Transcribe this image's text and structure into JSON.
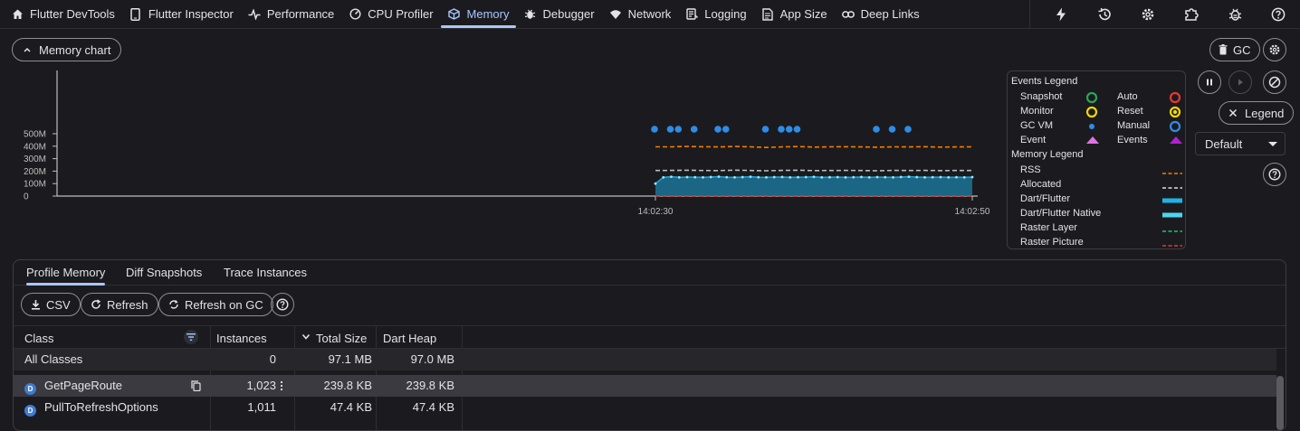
{
  "tabs": [
    {
      "id": "devtools",
      "label": "Flutter DevTools",
      "icon": "home-icon"
    },
    {
      "id": "inspector",
      "label": "Flutter Inspector",
      "icon": "phone-icon"
    },
    {
      "id": "performance",
      "label": "Performance",
      "icon": "pulse-icon"
    },
    {
      "id": "cpu",
      "label": "CPU Profiler",
      "icon": "timer-icon"
    },
    {
      "id": "memory",
      "label": "Memory",
      "icon": "cube-icon",
      "active": true
    },
    {
      "id": "debugger",
      "label": "Debugger",
      "icon": "bug-icon"
    },
    {
      "id": "network",
      "label": "Network",
      "icon": "wifi-icon"
    },
    {
      "id": "logging",
      "label": "Logging",
      "icon": "logging-icon"
    },
    {
      "id": "appsize",
      "label": "App Size",
      "icon": "file-icon"
    },
    {
      "id": "deeplinks",
      "label": "Deep Links",
      "icon": "link-icon"
    }
  ],
  "toolbar_right_icons": [
    "bolt-icon",
    "history-icon",
    "settings-icon",
    "extension-icon",
    "bug-report-icon",
    "help-icon"
  ],
  "chart_toggle_label": "Memory chart",
  "gc_label": "GC",
  "legend_button_label": "Legend",
  "dropdown_value": "Default",
  "chart_data": {
    "type": "area",
    "y_ticks": [
      "500M",
      "400M",
      "300M",
      "200M",
      "100M",
      "0"
    ],
    "x_ticks": [
      "14:02:30",
      "14:02:50"
    ],
    "ylim": [
      0,
      500
    ],
    "xlim": [
      0,
      20
    ],
    "series": [
      {
        "name": "RSS",
        "style": "dashed",
        "color": "#f57c00",
        "x": [
          0,
          1,
          2,
          3,
          4,
          5,
          6,
          7,
          8,
          9,
          10,
          11,
          12,
          13,
          14,
          15,
          16,
          17,
          18,
          19,
          20
        ],
        "values": [
          395,
          395,
          398,
          396,
          394,
          398,
          395,
          390,
          394,
          397,
          393,
          395,
          396,
          394,
          392,
          395,
          394,
          396,
          393,
          394,
          395
        ]
      },
      {
        "name": "Allocated",
        "style": "dashed",
        "color": "#bdbdbd",
        "x": [
          0,
          1,
          2,
          3,
          4,
          5,
          6,
          7,
          8,
          9,
          10,
          11,
          12,
          13,
          14,
          15,
          16,
          17,
          18,
          19,
          20
        ],
        "values": [
          205,
          206,
          207,
          205,
          204,
          208,
          205,
          203,
          206,
          207,
          204,
          205,
          206,
          205,
          203,
          206,
          205,
          206,
          204,
          205,
          205
        ]
      },
      {
        "name": "Dart/Flutter",
        "style": "area",
        "color": "#1fa3d6",
        "x": [
          0,
          0.5,
          1,
          1.5,
          2,
          2.5,
          3,
          3.5,
          4,
          4.5,
          5,
          5.5,
          6,
          6.5,
          7,
          7.5,
          8,
          8.5,
          9,
          9.5,
          10,
          10.5,
          11,
          11.5,
          12,
          12.5,
          13,
          13.5,
          14,
          14.5,
          15,
          15.5,
          16,
          16.5,
          17,
          17.5,
          18,
          18.5,
          19,
          19.5,
          20
        ],
        "values": [
          100,
          150,
          155,
          150,
          152,
          151,
          150,
          153,
          156,
          151,
          150,
          152,
          155,
          151,
          150,
          152,
          153,
          150,
          151,
          152,
          154,
          150,
          151,
          152,
          150,
          151,
          153,
          150,
          152,
          151,
          150,
          153,
          155,
          152,
          150,
          151,
          152,
          150,
          151,
          150,
          152
        ]
      }
    ],
    "gc_events_x": [
      0,
      1,
      1.5,
      2.5,
      4,
      4.5,
      7,
      8,
      8.5,
      9,
      14,
      15,
      16
    ]
  },
  "events_legend": {
    "title": "Events Legend",
    "items": [
      {
        "label": "Snapshot",
        "symbol": "ring",
        "color": "#26a65b"
      },
      {
        "label": "Auto",
        "symbol": "ring",
        "color": "#e53935"
      },
      {
        "label": "Monitor",
        "symbol": "ring",
        "color": "#f6d800"
      },
      {
        "label": "Reset",
        "symbol": "ring-fill",
        "color": "#f6d800"
      },
      {
        "label": "GC VM",
        "symbol": "dot",
        "color": "#2f8ce6"
      },
      {
        "label": "Manual",
        "symbol": "ring",
        "color": "#2f8ce6"
      },
      {
        "label": "Event",
        "symbol": "triangle",
        "color": "#e071e6"
      },
      {
        "label": "Events",
        "symbol": "triangle",
        "color": "#b21fd0"
      }
    ]
  },
  "memory_legend": {
    "title": "Memory Legend",
    "items": [
      {
        "label": "RSS",
        "symbol": "dashed",
        "color": "#f57c00"
      },
      {
        "label": "Allocated",
        "symbol": "dashed",
        "color": "#e0e0e0"
      },
      {
        "label": "Dart/Flutter",
        "symbol": "bar",
        "color": "#1fb3e6"
      },
      {
        "label": "Dart/Flutter Native",
        "symbol": "bar",
        "color": "#4fd4f2"
      },
      {
        "label": "Raster Layer",
        "symbol": "dashed",
        "color": "#1fc56a"
      },
      {
        "label": "Raster Picture",
        "symbol": "dashed",
        "color": "#e53935"
      }
    ]
  },
  "sub_tabs": [
    "Profile Memory",
    "Diff Snapshots",
    "Trace Instances"
  ],
  "actions": {
    "csv": "CSV",
    "refresh": "Refresh",
    "refresh_gc": "Refresh on GC"
  },
  "table": {
    "headers": [
      "Class",
      "Instances",
      "Total Size",
      "Dart Heap"
    ],
    "all_classes": {
      "name": "All Classes",
      "instances": "0",
      "total": "97.1 MB",
      "heap": "97.0 MB"
    },
    "rows": [
      {
        "badge": "D",
        "name": "GetPageRoute",
        "instances": "1,023",
        "total": "239.8 KB",
        "heap": "239.8 KB",
        "selected": true
      },
      {
        "badge": "D",
        "name": "PullToRefreshOptions",
        "instances": "1,011",
        "total": "47.4 KB",
        "heap": "47.4 KB"
      }
    ]
  }
}
